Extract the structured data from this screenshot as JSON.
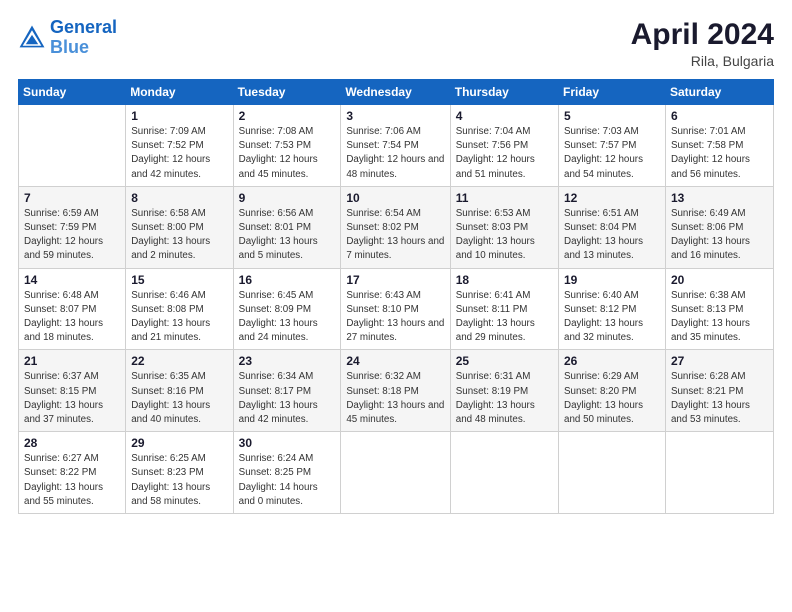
{
  "header": {
    "logo_line1": "General",
    "logo_line2": "Blue",
    "month_year": "April 2024",
    "location": "Rila, Bulgaria"
  },
  "weekdays": [
    "Sunday",
    "Monday",
    "Tuesday",
    "Wednesday",
    "Thursday",
    "Friday",
    "Saturday"
  ],
  "weeks": [
    [
      null,
      {
        "day": 1,
        "sunrise": "7:09 AM",
        "sunset": "7:52 PM",
        "daylight": "12 hours and 42 minutes."
      },
      {
        "day": 2,
        "sunrise": "7:08 AM",
        "sunset": "7:53 PM",
        "daylight": "12 hours and 45 minutes."
      },
      {
        "day": 3,
        "sunrise": "7:06 AM",
        "sunset": "7:54 PM",
        "daylight": "12 hours and 48 minutes."
      },
      {
        "day": 4,
        "sunrise": "7:04 AM",
        "sunset": "7:56 PM",
        "daylight": "12 hours and 51 minutes."
      },
      {
        "day": 5,
        "sunrise": "7:03 AM",
        "sunset": "7:57 PM",
        "daylight": "12 hours and 54 minutes."
      },
      {
        "day": 6,
        "sunrise": "7:01 AM",
        "sunset": "7:58 PM",
        "daylight": "12 hours and 56 minutes."
      }
    ],
    [
      {
        "day": 7,
        "sunrise": "6:59 AM",
        "sunset": "7:59 PM",
        "daylight": "12 hours and 59 minutes."
      },
      {
        "day": 8,
        "sunrise": "6:58 AM",
        "sunset": "8:00 PM",
        "daylight": "13 hours and 2 minutes."
      },
      {
        "day": 9,
        "sunrise": "6:56 AM",
        "sunset": "8:01 PM",
        "daylight": "13 hours and 5 minutes."
      },
      {
        "day": 10,
        "sunrise": "6:54 AM",
        "sunset": "8:02 PM",
        "daylight": "13 hours and 7 minutes."
      },
      {
        "day": 11,
        "sunrise": "6:53 AM",
        "sunset": "8:03 PM",
        "daylight": "13 hours and 10 minutes."
      },
      {
        "day": 12,
        "sunrise": "6:51 AM",
        "sunset": "8:04 PM",
        "daylight": "13 hours and 13 minutes."
      },
      {
        "day": 13,
        "sunrise": "6:49 AM",
        "sunset": "8:06 PM",
        "daylight": "13 hours and 16 minutes."
      }
    ],
    [
      {
        "day": 14,
        "sunrise": "6:48 AM",
        "sunset": "8:07 PM",
        "daylight": "13 hours and 18 minutes."
      },
      {
        "day": 15,
        "sunrise": "6:46 AM",
        "sunset": "8:08 PM",
        "daylight": "13 hours and 21 minutes."
      },
      {
        "day": 16,
        "sunrise": "6:45 AM",
        "sunset": "8:09 PM",
        "daylight": "13 hours and 24 minutes."
      },
      {
        "day": 17,
        "sunrise": "6:43 AM",
        "sunset": "8:10 PM",
        "daylight": "13 hours and 27 minutes."
      },
      {
        "day": 18,
        "sunrise": "6:41 AM",
        "sunset": "8:11 PM",
        "daylight": "13 hours and 29 minutes."
      },
      {
        "day": 19,
        "sunrise": "6:40 AM",
        "sunset": "8:12 PM",
        "daylight": "13 hours and 32 minutes."
      },
      {
        "day": 20,
        "sunrise": "6:38 AM",
        "sunset": "8:13 PM",
        "daylight": "13 hours and 35 minutes."
      }
    ],
    [
      {
        "day": 21,
        "sunrise": "6:37 AM",
        "sunset": "8:15 PM",
        "daylight": "13 hours and 37 minutes."
      },
      {
        "day": 22,
        "sunrise": "6:35 AM",
        "sunset": "8:16 PM",
        "daylight": "13 hours and 40 minutes."
      },
      {
        "day": 23,
        "sunrise": "6:34 AM",
        "sunset": "8:17 PM",
        "daylight": "13 hours and 42 minutes."
      },
      {
        "day": 24,
        "sunrise": "6:32 AM",
        "sunset": "8:18 PM",
        "daylight": "13 hours and 45 minutes."
      },
      {
        "day": 25,
        "sunrise": "6:31 AM",
        "sunset": "8:19 PM",
        "daylight": "13 hours and 48 minutes."
      },
      {
        "day": 26,
        "sunrise": "6:29 AM",
        "sunset": "8:20 PM",
        "daylight": "13 hours and 50 minutes."
      },
      {
        "day": 27,
        "sunrise": "6:28 AM",
        "sunset": "8:21 PM",
        "daylight": "13 hours and 53 minutes."
      }
    ],
    [
      {
        "day": 28,
        "sunrise": "6:27 AM",
        "sunset": "8:22 PM",
        "daylight": "13 hours and 55 minutes."
      },
      {
        "day": 29,
        "sunrise": "6:25 AM",
        "sunset": "8:23 PM",
        "daylight": "13 hours and 58 minutes."
      },
      {
        "day": 30,
        "sunrise": "6:24 AM",
        "sunset": "8:25 PM",
        "daylight": "14 hours and 0 minutes."
      },
      null,
      null,
      null,
      null
    ]
  ]
}
